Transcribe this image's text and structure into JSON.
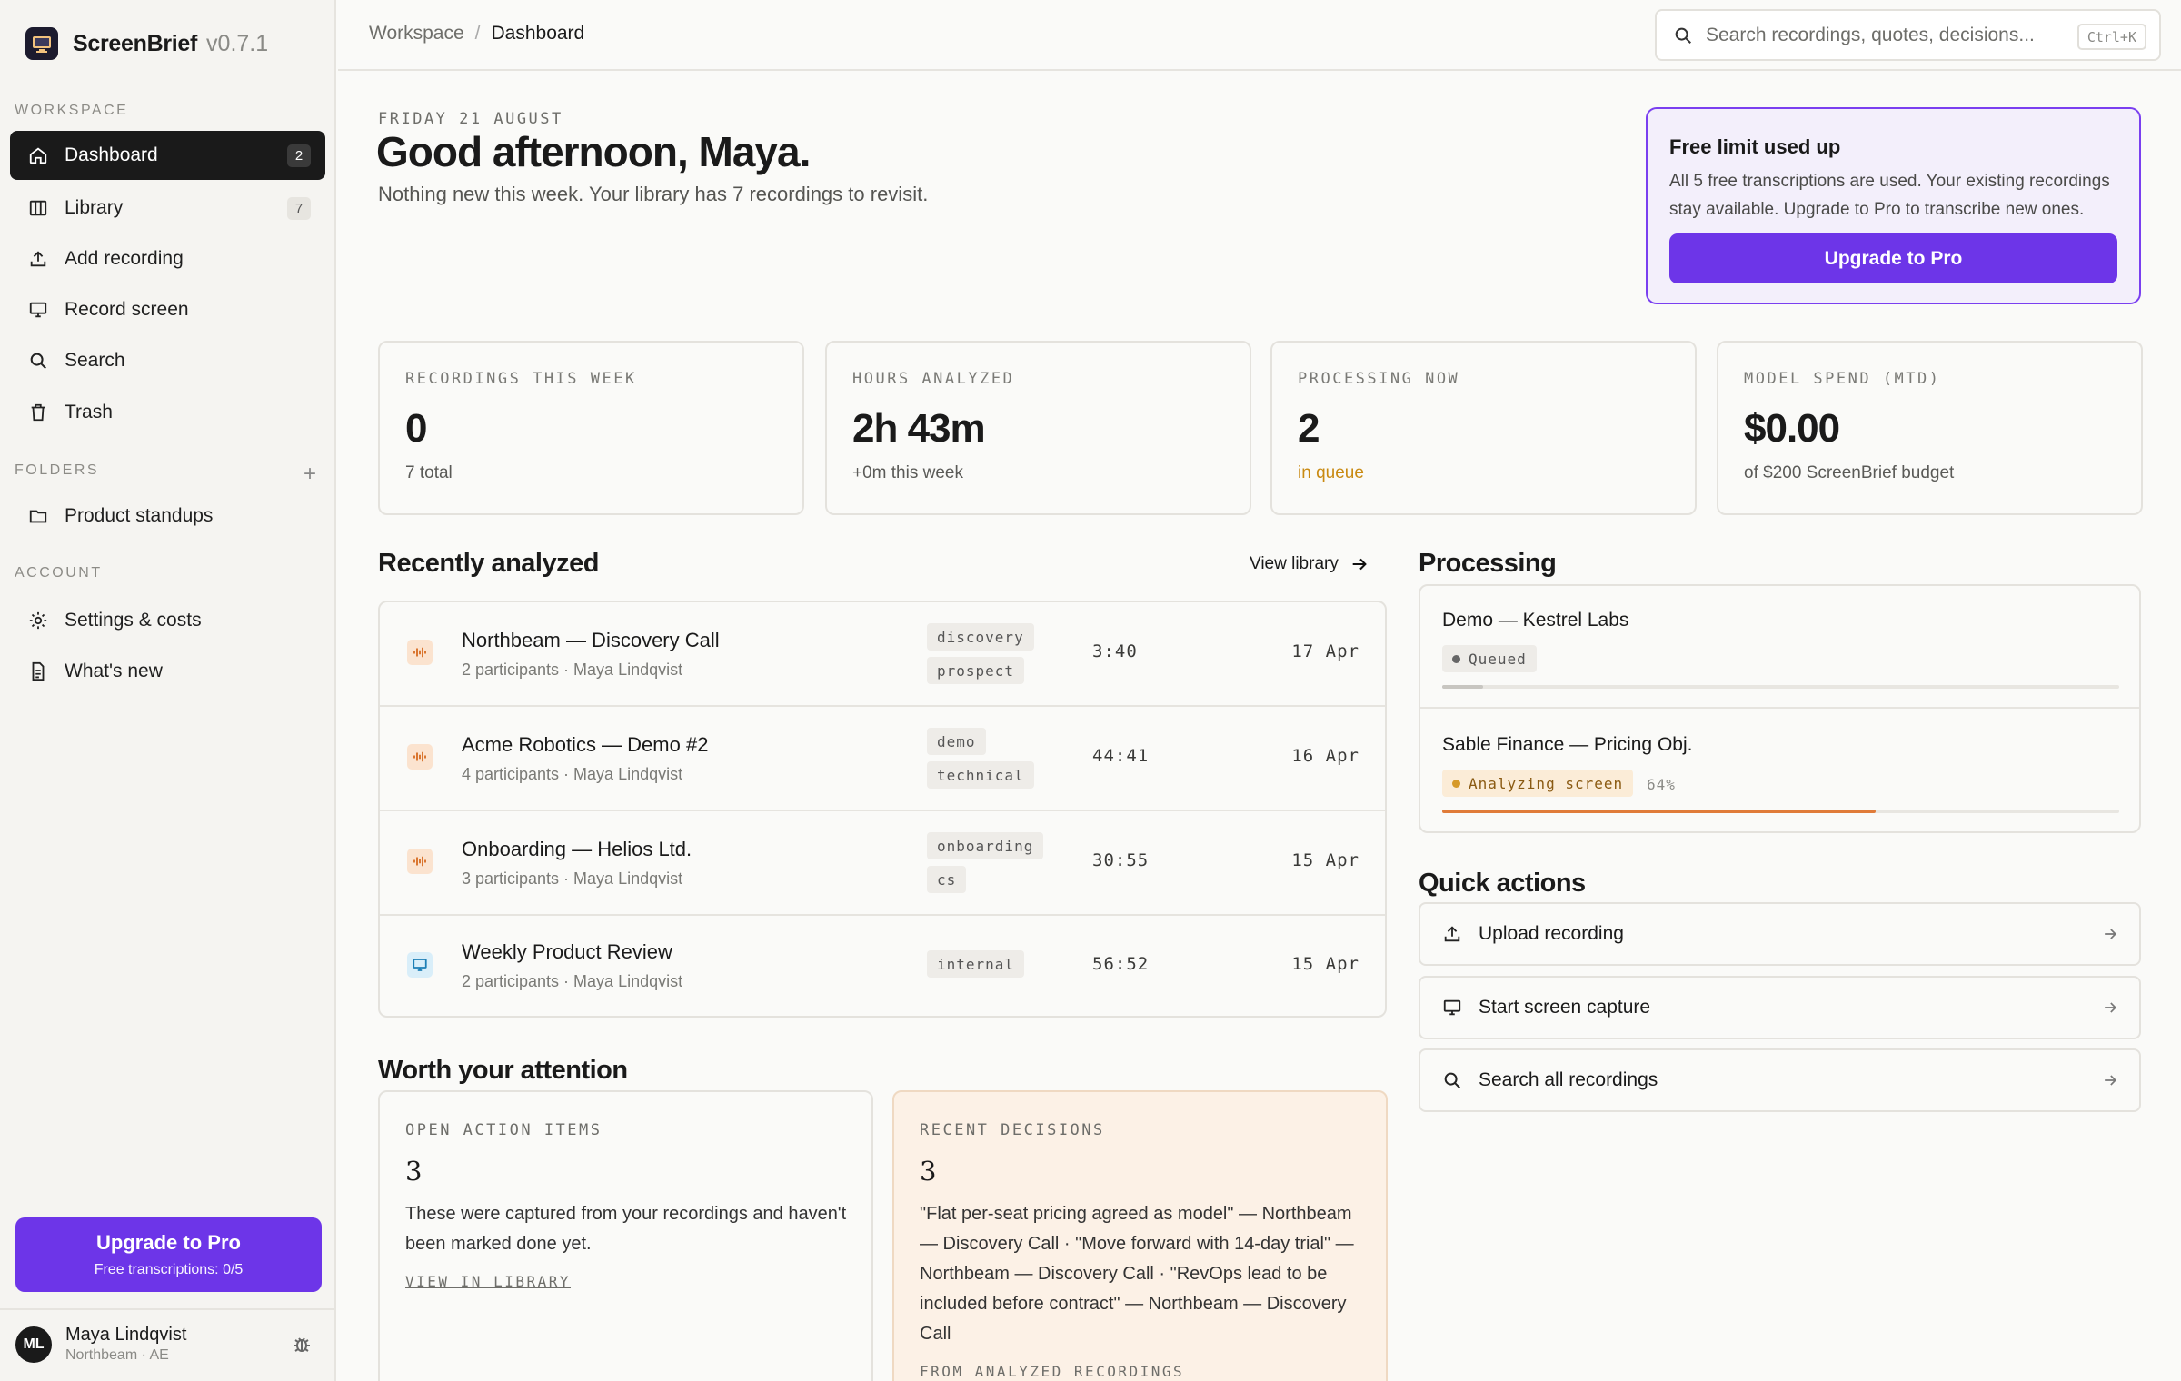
{
  "app": {
    "name": "ScreenBrief",
    "version": "v0.7.1"
  },
  "sidebar": {
    "workspace_label": "WORKSPACE",
    "items": [
      {
        "label": "Dashboard",
        "badge": "2"
      },
      {
        "label": "Library",
        "badge": "7"
      },
      {
        "label": "Add recording"
      },
      {
        "label": "Record screen"
      },
      {
        "label": "Search"
      },
      {
        "label": "Trash"
      }
    ],
    "folders_label": "FOLDERS",
    "folders": [
      {
        "label": "Product standups"
      }
    ],
    "account_label": "ACCOUNT",
    "account_items": [
      {
        "label": "Settings & costs"
      },
      {
        "label": "What's new"
      }
    ],
    "upgrade": {
      "title": "Upgrade to Pro",
      "subtitle": "Free transcriptions: 0/5"
    },
    "user": {
      "initials": "ML",
      "name": "Maya Lindqvist",
      "org": "Northbeam · AE"
    }
  },
  "breadcrumb": {
    "parent": "Workspace",
    "separator": "/",
    "current": "Dashboard"
  },
  "search": {
    "placeholder": "Search recordings, quotes, decisions...",
    "shortcut": "Ctrl+K"
  },
  "hero": {
    "date": "FRIDAY 21 AUGUST",
    "greeting": "Good afternoon, Maya.",
    "subtitle": "Nothing new this week. Your library has 7 recordings to revisit."
  },
  "limit_banner": {
    "title": "Free limit used up",
    "text": "All 5 free transcriptions are used. Your existing recordings stay available. Upgrade to Pro to transcribe new ones.",
    "button": "Upgrade to Pro"
  },
  "stats": [
    {
      "label": "RECORDINGS THIS WEEK",
      "value": "0",
      "note": "7 total"
    },
    {
      "label": "HOURS ANALYZED",
      "value": "2h 43m",
      "note": "+0m this week"
    },
    {
      "label": "PROCESSING NOW",
      "value": "2",
      "note": "in queue"
    },
    {
      "label": "MODEL SPEND (MTD)",
      "value": "$0.00",
      "note": "of $200 ScreenBrief budget"
    }
  ],
  "recent": {
    "title": "Recently analyzed",
    "view_library": "View library",
    "rows": [
      {
        "title": "Northbeam — Discovery Call",
        "meta": "2 participants · Maya Lindqvist",
        "tags": [
          "discovery",
          "prospect"
        ],
        "duration": "3:40",
        "date": "17 Apr",
        "icon": "audio-wave-icon"
      },
      {
        "title": "Acme Robotics — Demo #2",
        "meta": "4 participants · Maya Lindqvist",
        "tags": [
          "demo",
          "technical"
        ],
        "duration": "44:41",
        "date": "16 Apr",
        "icon": "audio-wave-icon"
      },
      {
        "title": "Onboarding — Helios Ltd.",
        "meta": "3 participants · Maya Lindqvist",
        "tags": [
          "onboarding",
          "cs"
        ],
        "duration": "30:55",
        "date": "15 Apr",
        "icon": "audio-wave-icon"
      },
      {
        "title": "Weekly Product Review",
        "meta": "2 participants · Maya Lindqvist",
        "tags": [
          "internal"
        ],
        "duration": "56:52",
        "date": "15 Apr",
        "icon": "monitor-icon"
      }
    ]
  },
  "processing": {
    "title": "Processing",
    "items": [
      {
        "title": "Demo — Kestrel Labs",
        "status": "Queued",
        "progress": 0.06
      },
      {
        "title": "Sable Finance — Pricing Obj.",
        "status": "Analyzing screen",
        "percent": "64%",
        "progress": 0.64
      }
    ]
  },
  "quick_actions": {
    "title": "Quick actions",
    "items": [
      {
        "label": "Upload recording"
      },
      {
        "label": "Start screen capture"
      },
      {
        "label": "Search all recordings"
      }
    ]
  },
  "attention": {
    "title": "Worth your attention",
    "action_items": {
      "label": "OPEN ACTION ITEMS",
      "count": "3",
      "text": "These were captured from your recordings and haven't been marked done yet.",
      "link": "VIEW IN LIBRARY"
    },
    "decisions": {
      "label": "RECENT DECISIONS",
      "count": "3",
      "text": "\"Flat per-seat pricing agreed as model\" — Northbeam — Discovery Call · \"Move forward with 14-day trial\" — Northbeam — Discovery Call · \"RevOps lead to be included before contract\" — Northbeam — Discovery Call",
      "footer": "FROM ANALYZED RECORDINGS"
    }
  },
  "colors": {
    "accent": "#6d35e8",
    "warning": "#c98a12",
    "progress": "#e07b39",
    "dark": "#1a1a1a"
  }
}
